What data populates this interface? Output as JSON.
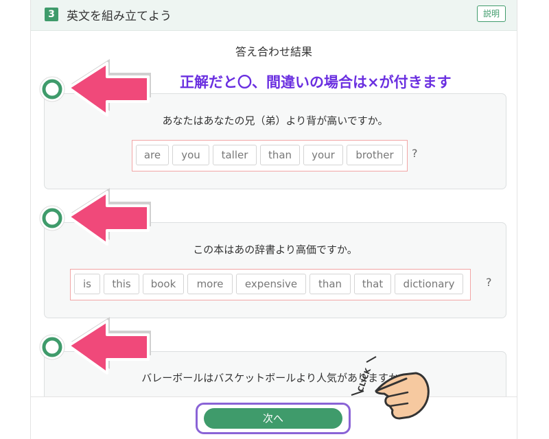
{
  "header": {
    "step_number": "3",
    "title": "英文を組み立てよう",
    "help_label": "説明"
  },
  "result_title": "答え合わせ結果",
  "annotation": "正解だと〇、間違いの場合は×が付きます",
  "questions": [
    {
      "prompt": "あなたはあなたの兄（弟）より背が高いですか。",
      "words": [
        "are",
        "you",
        "taller",
        "than",
        "your",
        "brother"
      ],
      "punctuation": "?",
      "result": "correct"
    },
    {
      "prompt": "この本はあの辞書より高価ですか。",
      "words": [
        "is",
        "this",
        "book",
        "more",
        "expensive",
        "than",
        "that",
        "dictionary"
      ],
      "punctuation": "?",
      "result": "correct"
    },
    {
      "prompt": "バレーボールはバスケットボールより人気がありますか。",
      "result": "correct"
    }
  ],
  "footer": {
    "next_label": "次へ"
  },
  "click_hint": "CLICK",
  "colors": {
    "accent_green": "#3f9b6b",
    "arrow_pink": "#f0497a",
    "highlight_purple": "#8a63d6",
    "error_box": "#f2a5a5"
  }
}
